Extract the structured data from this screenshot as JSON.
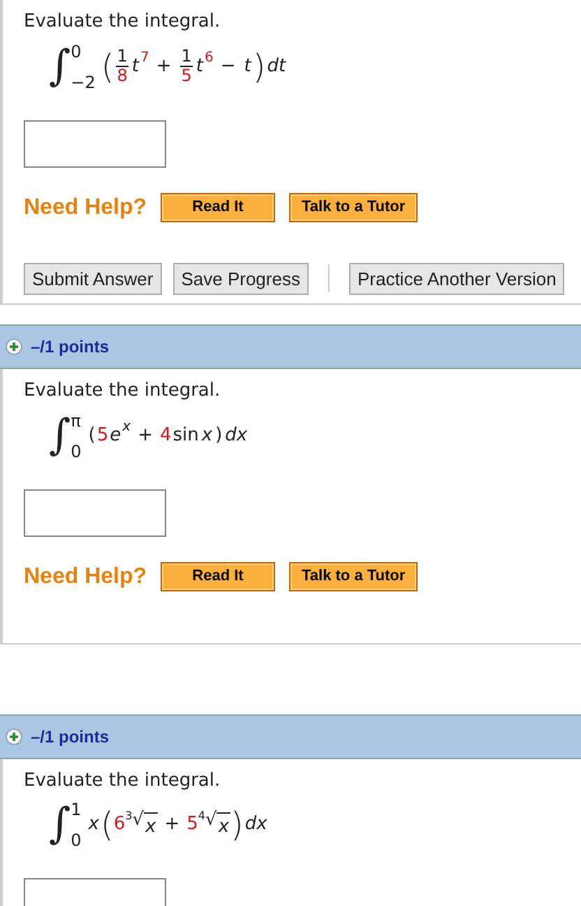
{
  "questions": [
    {
      "prompt": "Evaluate the integral.",
      "integral": {
        "sign": "∫",
        "upper": "0",
        "lower": "−2",
        "integrand": [
          {
            "kind": "paren",
            "text": "("
          },
          {
            "kind": "frac",
            "num": "1",
            "den": "8"
          },
          {
            "kind": "var",
            "text": "t"
          },
          {
            "kind": "sup",
            "text": "7"
          },
          {
            "kind": "op",
            "text": "+"
          },
          {
            "kind": "frac",
            "num": "1",
            "den": "5"
          },
          {
            "kind": "var",
            "text": "t"
          },
          {
            "kind": "sup",
            "text": "6"
          },
          {
            "kind": "op",
            "text": "−"
          },
          {
            "kind": "var",
            "text": "t"
          },
          {
            "kind": "paren",
            "text": ")"
          },
          {
            "kind": "var",
            "text": "dt"
          }
        ]
      },
      "help": {
        "label": "Need Help?",
        "buttons": [
          "Read It",
          "Talk to a Tutor"
        ]
      },
      "actions": [
        "Submit Answer",
        "Save Progress"
      ],
      "extra_action": "Practice Another Version"
    },
    {
      "points": "–/1 points",
      "prompt": "Evaluate the integral.",
      "integral": {
        "sign": "∫",
        "upper": "π",
        "lower": "0",
        "integrand": [
          {
            "kind": "text",
            "text": "("
          },
          {
            "kind": "coef",
            "text": "5"
          },
          {
            "kind": "var",
            "text": "e"
          },
          {
            "kind": "supvar",
            "text": "x"
          },
          {
            "kind": "op",
            "text": "+"
          },
          {
            "kind": "coef",
            "text": "4"
          },
          {
            "kind": "text",
            "text": "sin"
          },
          {
            "kind": "var",
            "text": "x"
          },
          {
            "kind": "text",
            "text": ")"
          },
          {
            "kind": "var",
            "text": "dx"
          }
        ]
      },
      "help": {
        "label": "Need Help?",
        "buttons": [
          "Read It",
          "Talk to a Tutor"
        ]
      }
    },
    {
      "points": "–/1 points",
      "prompt": "Evaluate the integral.",
      "integral": {
        "sign": "∫",
        "upper": "1",
        "lower": "0",
        "integrand": [
          {
            "kind": "var",
            "text": "x"
          },
          {
            "kind": "paren",
            "text": "("
          },
          {
            "kind": "coef",
            "text": "6"
          },
          {
            "kind": "root",
            "index": "3",
            "symbol": "√",
            "radicand": "x"
          },
          {
            "kind": "op",
            "text": "+"
          },
          {
            "kind": "coef",
            "text": "5"
          },
          {
            "kind": "root",
            "index": "4",
            "symbol": "√",
            "radicand": "x"
          },
          {
            "kind": "paren",
            "text": ")"
          },
          {
            "kind": "var",
            "text": "dx"
          }
        ]
      }
    }
  ]
}
